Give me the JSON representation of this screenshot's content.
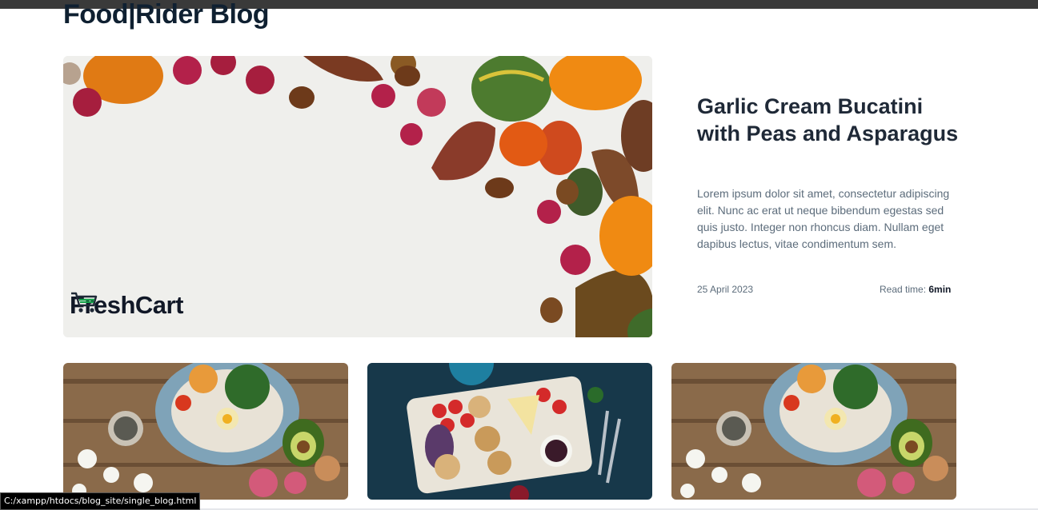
{
  "page": {
    "heading": "Food|Rider Blog"
  },
  "featured": {
    "brand_logo_text": "FreshCart",
    "title": "Garlic Cream Bucatini with Peas and Asparagus",
    "excerpt": "Lorem ipsum dolor sit amet, consectetur adipiscing elit. Nunc ac erat ut neque bibendum egestas sed quis justo. Integer non rhoncus diam. Nullam eget dapibus lectus, vitae condimentum sem.",
    "date": "25 April 2023",
    "read_time_label": "Read time:",
    "read_time_value": "6min"
  },
  "cards": [
    {
      "image": "salad-bowl-on-wood"
    },
    {
      "image": "cheese-fruit-board-on-blue"
    },
    {
      "image": "salad-bowl-on-wood"
    }
  ],
  "status_bar": {
    "url": "C:/xampp/htdocs/blog_site/single_blog.html"
  },
  "icons": {
    "brand": "shopping-cart-icon"
  },
  "colors": {
    "heading": "#0f2031",
    "body_text": "#5c6c7b",
    "accent_green": "#15a34a"
  }
}
